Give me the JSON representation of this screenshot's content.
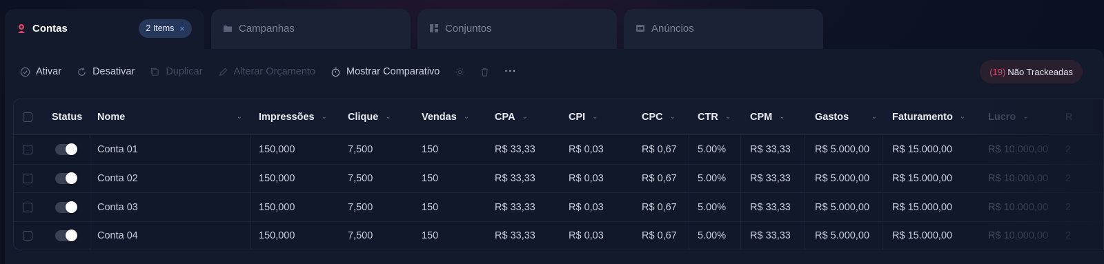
{
  "tabs": [
    {
      "label": "Contas",
      "icon": "person-icon",
      "active": true,
      "badge": "2 Items",
      "badge_close": "×"
    },
    {
      "label": "Campanhas",
      "icon": "folder-icon"
    },
    {
      "label": "Conjuntos",
      "icon": "grid-icon"
    },
    {
      "label": "Anúncios",
      "icon": "ad-icon"
    }
  ],
  "toolbar": {
    "ativar": "Ativar",
    "desativar": "Desativar",
    "duplicar": "Duplicar",
    "alterar_orcamento": "Alterar Orçamento",
    "mostrar_comparativo": "Mostrar Comparativo",
    "more": "···",
    "nao_trackeadas_count": "(19)",
    "nao_trackeadas_label": "Não Trackeadas"
  },
  "table": {
    "headers": {
      "status": "Status",
      "nome": "Nome",
      "impressoes": "Impressões",
      "clique": "Clique",
      "vendas": "Vendas",
      "cpa": "CPA",
      "cpi": "CPI",
      "cpc": "CPC",
      "ctr": "CTR",
      "cpm": "CPM",
      "gastos": "Gastos",
      "faturamento": "Faturamento",
      "lucro": "Lucro",
      "roi": "R"
    },
    "rows": [
      {
        "nome": "Conta 01",
        "impressoes": "150,000",
        "clique": "7,500",
        "vendas": "150",
        "cpa": "R$ 33,33",
        "cpi": "R$ 0,03",
        "cpc": "R$ 0,67",
        "ctr": "5.00%",
        "cpm": "R$ 33,33",
        "gastos": "R$ 5.000,00",
        "faturamento": "R$ 15.000,00",
        "lucro": "R$ 10.000,00",
        "roi": "2"
      },
      {
        "nome": "Conta 02",
        "impressoes": "150,000",
        "clique": "7,500",
        "vendas": "150",
        "cpa": "R$ 33,33",
        "cpi": "R$ 0,03",
        "cpc": "R$ 0,67",
        "ctr": "5.00%",
        "cpm": "R$ 33,33",
        "gastos": "R$ 5.000,00",
        "faturamento": "R$ 15.000,00",
        "lucro": "R$ 10.000,00",
        "roi": "2"
      },
      {
        "nome": "Conta 03",
        "impressoes": "150,000",
        "clique": "7,500",
        "vendas": "150",
        "cpa": "R$ 33,33",
        "cpi": "R$ 0,03",
        "cpc": "R$ 0,67",
        "ctr": "5.00%",
        "cpm": "R$ 33,33",
        "gastos": "R$ 5.000,00",
        "faturamento": "R$ 15.000,00",
        "lucro": "R$ 10.000,00",
        "roi": "2"
      },
      {
        "nome": "Conta 04",
        "impressoes": "150,000",
        "clique": "7,500",
        "vendas": "150",
        "cpa": "R$ 33,33",
        "cpi": "R$ 0,03",
        "cpc": "R$ 0,67",
        "ctr": "5.00%",
        "cpm": "R$ 33,33",
        "gastos": "R$ 5.000,00",
        "faturamento": "R$ 15.000,00",
        "lucro": "R$ 10.000,00",
        "roi": "2"
      }
    ]
  },
  "colors": {
    "accent": "#e0456b",
    "badge_bg": "#25375a",
    "panel_bg": "#131a2c",
    "page_bg": "#0c1222"
  }
}
